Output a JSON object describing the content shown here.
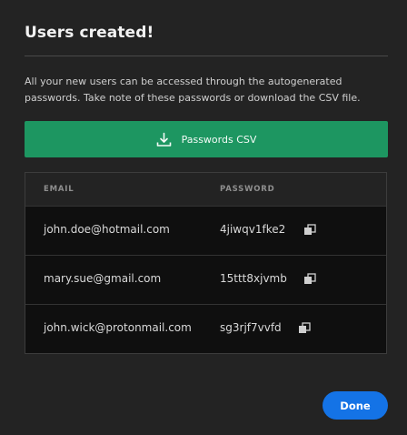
{
  "dialog": {
    "title": "Users created!",
    "description": "All your new users can be accessed through the autogenerated passwords. Take note of these passwords or download the CSV file.",
    "csv_button_label": "Passwords CSV",
    "done_button_label": "Done"
  },
  "table": {
    "headers": {
      "email": "EMAIL",
      "password": "PASSWORD"
    },
    "rows": [
      {
        "email": "john.doe@hotmail.com",
        "password": "4jiwqv1fke2"
      },
      {
        "email": "mary.sue@gmail.com",
        "password": "15ttt8xjvmb"
      },
      {
        "email": "john.wick@protonmail.com",
        "password": "sg3rjf7vvfd"
      }
    ]
  },
  "icons": {
    "download": "download-icon",
    "copy": "copy-icon"
  },
  "colors": {
    "background": "#232323",
    "csv_button": "#1d9661",
    "done_button": "#1473e6",
    "table_row": "#0f0f0f"
  }
}
